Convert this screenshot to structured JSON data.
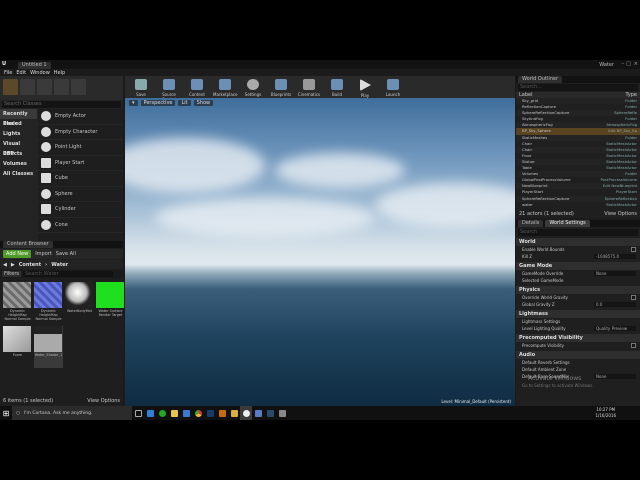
{
  "window": {
    "title": "Untitled 1",
    "project": "Water",
    "menu": [
      "File",
      "Edit",
      "Window",
      "Help"
    ]
  },
  "modes": {
    "search_placeholder": "Search Classes",
    "categories": [
      "Recently Placed",
      "Basic",
      "Lights",
      "Visual Effects",
      "BSP",
      "Volumes",
      "All Classes"
    ],
    "items": [
      "Empty Actor",
      "Empty Character",
      "Point Light",
      "Player Start",
      "Cube",
      "Sphere",
      "Cylinder",
      "Cone"
    ]
  },
  "content_browser": {
    "tab": "Content Browser",
    "add_new": "Add New",
    "import": "Import",
    "save_all": "Save All",
    "path": [
      "Content",
      "Water"
    ],
    "filters": "Filters",
    "search": "Search Water",
    "assets": [
      {
        "name": "Dynamic HeightMap Normal Sample",
        "color": "#8a8a8a"
      },
      {
        "name": "Dynamic HeightMap Normal Sample",
        "color": "#5a6ad0"
      },
      {
        "name": "WaterBodyMat",
        "color": "#e0e0e0"
      },
      {
        "name": "Water Surface Render Target",
        "color": "#20e020"
      },
      {
        "name": "Foam",
        "color": "#bdbdbd"
      },
      {
        "name": "Water_Shader_1",
        "color": "#9a9a9a"
      }
    ],
    "status": "6 items (1 selected)",
    "view_options": "View Options"
  },
  "toolbar": {
    "buttons": [
      "Save",
      "Source Control",
      "Content",
      "Marketplace",
      "Settings",
      "Blueprints",
      "Cinematics",
      "Build",
      "Play",
      "Launch"
    ]
  },
  "viewport": {
    "mode": "Perspective",
    "view": "Lit",
    "show": "Show",
    "level_text": "Level:  Minimal_Default (Persistent)"
  },
  "outliner": {
    "tab": "World Outliner",
    "search": "Search...",
    "col_label": "Label",
    "col_type": "Type",
    "rows": [
      [
        "Sky_grid",
        "Folder"
      ],
      [
        "ReflectionCapture",
        "Folder"
      ],
      [
        "SphereReflectionCapture",
        "SphereRefle"
      ],
      [
        "SkyAndFog",
        "Folder"
      ],
      [
        "AtmosphericFog",
        "AtmosphericFog"
      ],
      [
        "BP_Sky_Sphere",
        "Edit BP_Sky_Sp"
      ],
      [
        "StaticMeshes",
        "Folder"
      ],
      [
        "Chair",
        "StaticMeshActor"
      ],
      [
        "Chair",
        "StaticMeshActor"
      ],
      [
        "Floor",
        "StaticMeshActor"
      ],
      [
        "Statue",
        "StaticMeshActor"
      ],
      [
        "Table",
        "StaticMeshActor"
      ],
      [
        "Volumes",
        "Folder"
      ],
      [
        "GlobalPostProcessVolume",
        "PostProcessVolume"
      ],
      [
        "NewBlueprint",
        "Edit NewBlueprint"
      ],
      [
        "PlayerStart",
        "PlayerStart"
      ],
      [
        "SphereReflectionCapture",
        "SphereReflection"
      ],
      [
        "water",
        "StaticMeshActor"
      ]
    ],
    "footer": "21 actors (1 selected)",
    "view_options": "View Options"
  },
  "details": {
    "tabs": [
      "Details",
      "World Settings"
    ],
    "search": "Search",
    "sections": [
      {
        "title": "World",
        "rows": [
          [
            "Enable World Bounds",
            "chk"
          ],
          [
            "Kill Z",
            "-1048575.0"
          ]
        ]
      },
      {
        "title": "Game Mode",
        "rows": [
          [
            "GameMode Override",
            "None"
          ],
          [
            "Selected GameMode",
            ""
          ]
        ]
      },
      {
        "title": "Physics",
        "rows": [
          [
            "Override World Gravity",
            "chk"
          ],
          [
            "Global Gravity Z",
            "0.0"
          ]
        ]
      },
      {
        "title": "Lightmass",
        "rows": [
          [
            "Lightmass Settings",
            ""
          ],
          [
            "Level Lighting Quality",
            "Quality Preview"
          ]
        ]
      },
      {
        "title": "Precomputed Visibility",
        "rows": [
          [
            "Precompute Visibility",
            "chk"
          ]
        ]
      },
      {
        "title": "Audio",
        "rows": [
          [
            "Default Reverb Settings",
            ""
          ],
          [
            "Default Ambient Zone",
            ""
          ],
          [
            "Default Base SoundMix",
            "None"
          ]
        ]
      }
    ]
  },
  "watermark": {
    "line1": "Activate Windows",
    "line2": "Go to Settings to activate Windows."
  },
  "taskbar": {
    "cortana": "I'm Cortana. Ask me anything.",
    "time": "10:27 PM",
    "date": "1/16/2016"
  }
}
